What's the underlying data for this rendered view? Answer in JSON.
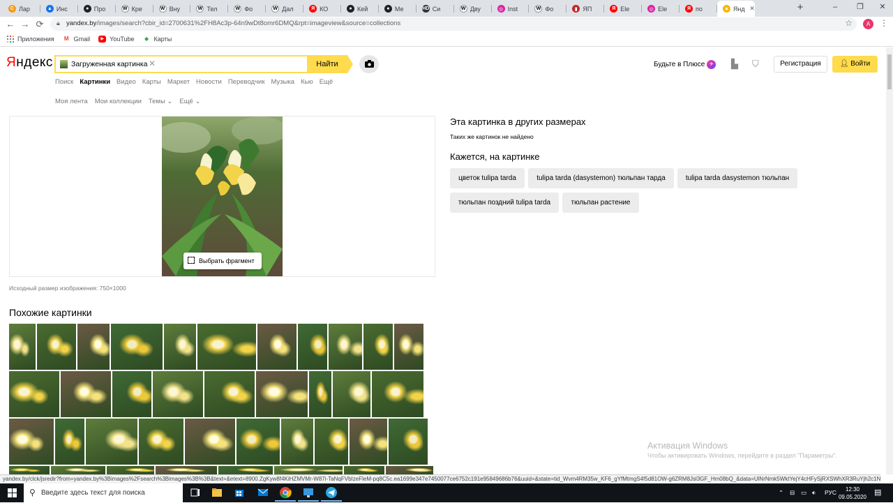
{
  "browser": {
    "tabs": [
      {
        "label": "Лар",
        "fav": "С",
        "color": "#f29b1d"
      },
      {
        "label": "Инс",
        "fav": "▲",
        "color": "#1a73e8"
      },
      {
        "label": "Про",
        "fav": "●",
        "color": "#222222"
      },
      {
        "label": "Кре",
        "fav": "W",
        "color": "#ffffff"
      },
      {
        "label": "Вну",
        "fav": "W",
        "color": "#ffffff"
      },
      {
        "label": "Тел",
        "fav": "W",
        "color": "#ffffff"
      },
      {
        "label": "Фо",
        "fav": "W",
        "color": "#ffffff"
      },
      {
        "label": "Дал",
        "fav": "W",
        "color": "#ffffff"
      },
      {
        "label": "КО",
        "fav": "Я",
        "color": "#ff0000"
      },
      {
        "label": "Кей",
        "fav": "●",
        "color": "#222222"
      },
      {
        "label": "Ме",
        "fav": "●",
        "color": "#222222"
      },
      {
        "label": "Си",
        "fav": "HD",
        "color": "#333333"
      },
      {
        "label": "Дву",
        "fav": "W",
        "color": "#ffffff"
      },
      {
        "label": "Inst",
        "fav": "◎",
        "color": "#d6249f"
      },
      {
        "label": "Фо",
        "fav": "W",
        "color": "#ffffff"
      },
      {
        "label": "ЯП",
        "fav": "▮",
        "color": "#c1272d"
      },
      {
        "label": "Ele",
        "fav": "Я",
        "color": "#ff0000"
      },
      {
        "label": "Ele",
        "fav": "◎",
        "color": "#d6249f"
      },
      {
        "label": "по",
        "fav": "Я",
        "color": "#ff0000"
      },
      {
        "label": "Янд",
        "fav": "▲",
        "color": "#f5b800"
      }
    ],
    "new_tab": "+",
    "win_minimize": "–",
    "win_restore": "❐",
    "win_close": "✕",
    "back": "←",
    "forward": "→",
    "reload": "⟳",
    "url_host": "yandex.by",
    "url_path": "/images/search?cbir_id=2700631%2FH8Ac3p-64n9wDt8omr6DMQ&rpt=imageview&source=collections",
    "profile_initial": "A",
    "bookmarks": [
      {
        "label": "Приложения",
        "icon": "apps-grid-icon"
      },
      {
        "label": "Gmail",
        "icon": "gmail-icon"
      },
      {
        "label": "YouTube",
        "icon": "youtube-icon"
      },
      {
        "label": "Карты",
        "icon": "maps-icon"
      }
    ]
  },
  "yandex": {
    "logo_first": "Я",
    "logo_rest": "ндекс",
    "search_chip": "Загруженная картинка",
    "find_button": "Найти",
    "plus_label": "Будьте в Плюсе",
    "register": "Регистрация",
    "login": "Войти",
    "services": [
      "Поиск",
      "Картинки",
      "Видео",
      "Карты",
      "Маркет",
      "Новости",
      "Переводчик",
      "Музыка",
      "Кью",
      "Ещё"
    ],
    "active_service": "Картинки",
    "subnav": [
      "Моя лента",
      "Мои коллекции",
      "Темы ⌄",
      "Ещё ⌄"
    ]
  },
  "result": {
    "select_fragment": "Выбрать фрагмент",
    "original_size": "Исходный размер изображения: 750×1000",
    "other_sizes_title": "Эта картинка в других размерах",
    "not_found": "Таких же картинок не найдено",
    "looks_like_title": "Кажется, на картинке",
    "tags": [
      "цветок tulipa tarda",
      "tulipa tarda (dasystemon) тюльпан тарда",
      "tulipa tarda dasystemon тюльпан",
      "тюльпан поздний tulipa tarda",
      "тюльпан растение"
    ],
    "similar_title": "Похожие картинки"
  },
  "status_url": "yandex.by/clck/jsredir?from=yandex.by%3Bimages%2Fsearch%3Bimages%3B%3B&text=&etext=8900.ZgKyw8f4KiHZMVMr-W87i-TaNqFVbIzeFleM-pq8C5c.ea1699e347e7450077ce6752c191e95849686b76&uuid=&state=tid_Wvm4RM35w_KF6_gYfMtmgS4f5d81OW-g6ZRM8Jsl3GF_Hm08bQ_&data=UlNrNmk5WktYejY4cHFySjRXSWhXR3RuYjh2c1NfSklv...",
  "watermark": {
    "line1": "Активация Windows",
    "line2": "Чтобы активировать Windows, перейдите в раздел \"Параметры\"."
  },
  "taskbar": {
    "search_placeholder": "Введите здесь текст для поиска",
    "lang": "РУС",
    "time": "12:30",
    "date": "09.05.2020"
  }
}
